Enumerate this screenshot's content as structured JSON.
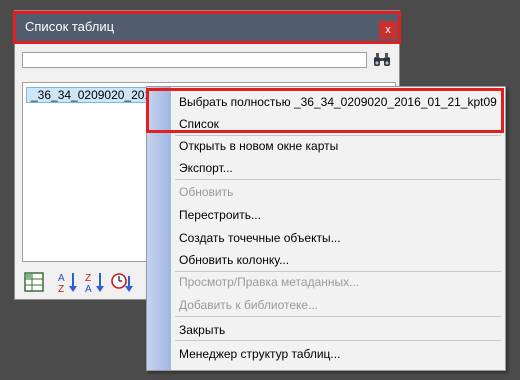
{
  "window": {
    "title": "Список таблиц",
    "close_label": "x",
    "search": {
      "value": ""
    },
    "list_items": [
      "_36_34_0209020_2016"
    ]
  },
  "context_menu": {
    "items": [
      {
        "label": "Выбрать полностью _36_34_0209020_2016_01_21_kpt09",
        "enabled": true
      },
      {
        "label": "Список",
        "enabled": true
      },
      {
        "label": "Открыть в новом окне карты",
        "enabled": true
      },
      {
        "label": "Экспорт...",
        "enabled": true
      },
      {
        "label": "Обновить",
        "enabled": false
      },
      {
        "label": "Перестроить...",
        "enabled": true
      },
      {
        "label": "Создать точечные объекты...",
        "enabled": true
      },
      {
        "label": "Обновить колонку...",
        "enabled": true
      },
      {
        "label": "Просмотр/Правка метаданных...",
        "enabled": false
      },
      {
        "label": "Добавить к библиотеке...",
        "enabled": false
      },
      {
        "label": "Закрыть",
        "enabled": true
      },
      {
        "label": "Менеджер структур таблиц...",
        "enabled": true
      }
    ]
  },
  "colors": {
    "highlight_border": "#e02020",
    "titlebar": "#515c6c",
    "close_button": "#c9302c",
    "selection": "#cde6f7"
  }
}
